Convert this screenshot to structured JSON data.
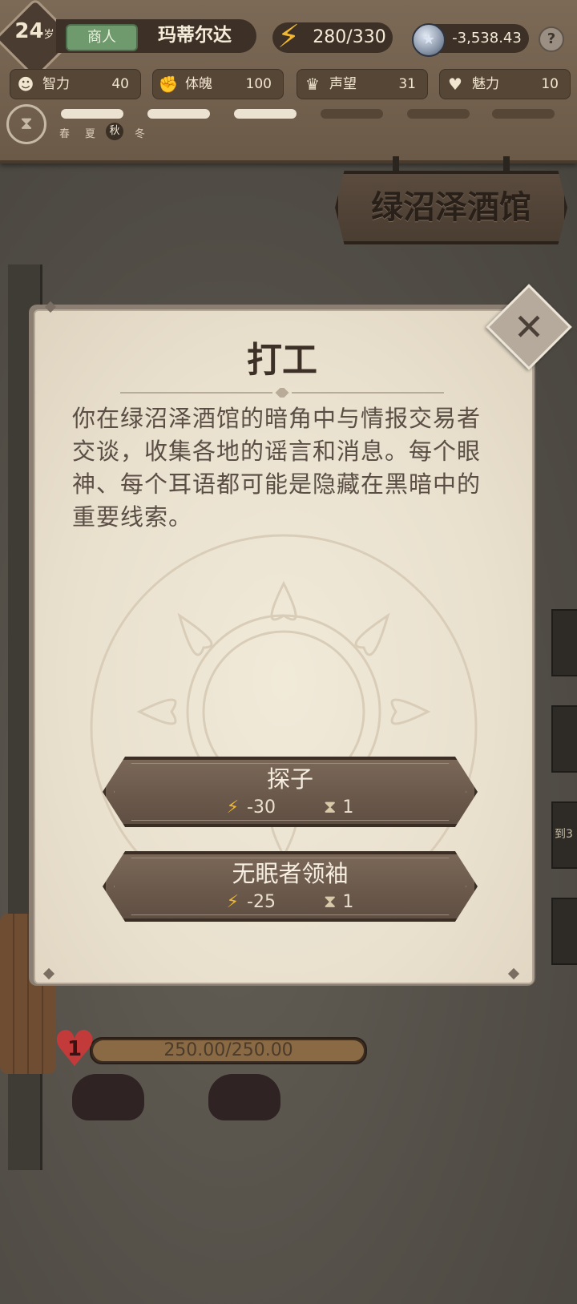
{
  "hud": {
    "age": "24",
    "age_unit": "岁",
    "job": "商人",
    "player_name": "玛蒂尔达",
    "energy": "280/330",
    "coins": "-3,538.43",
    "help": "?",
    "stats": [
      {
        "label": "智力",
        "value": "40",
        "icon": "brain-icon"
      },
      {
        "label": "体魄",
        "value": "100",
        "icon": "muscle-icon"
      },
      {
        "label": "声望",
        "value": "31",
        "icon": "reputation-icon"
      },
      {
        "label": "魅力",
        "value": "10",
        "icon": "heart-pulse-icon"
      }
    ],
    "seasons": [
      "春",
      "夏",
      "秋",
      "冬"
    ],
    "active_season": "秋",
    "season_progress_filled": 3,
    "season_progress_total": 6
  },
  "location": {
    "name": "绿沼泽酒馆"
  },
  "player_status": {
    "level": "1",
    "hp_text": "250.00/250.00",
    "hp_fraction": 1.0
  },
  "side_tabs": [
    {
      "label": "到3"
    }
  ],
  "modal": {
    "title": "打工",
    "description": "你在绿沼泽酒馆的暗角中与情报交易者交谈，收集各地的谣言和消息。每个眼神、每个耳语都可能是隐藏在黑暗中的重要线索。",
    "choices": [
      {
        "name": "探子",
        "energy_cost": "-30",
        "time_cost": "1"
      },
      {
        "name": "无眠者领袖",
        "energy_cost": "-25",
        "time_cost": "1"
      }
    ]
  },
  "colors": {
    "energy": "#f0b732",
    "job_tag": "#6f9a6e",
    "hp_heart": "#c23a3a",
    "parchment": "#ece4d3"
  }
}
